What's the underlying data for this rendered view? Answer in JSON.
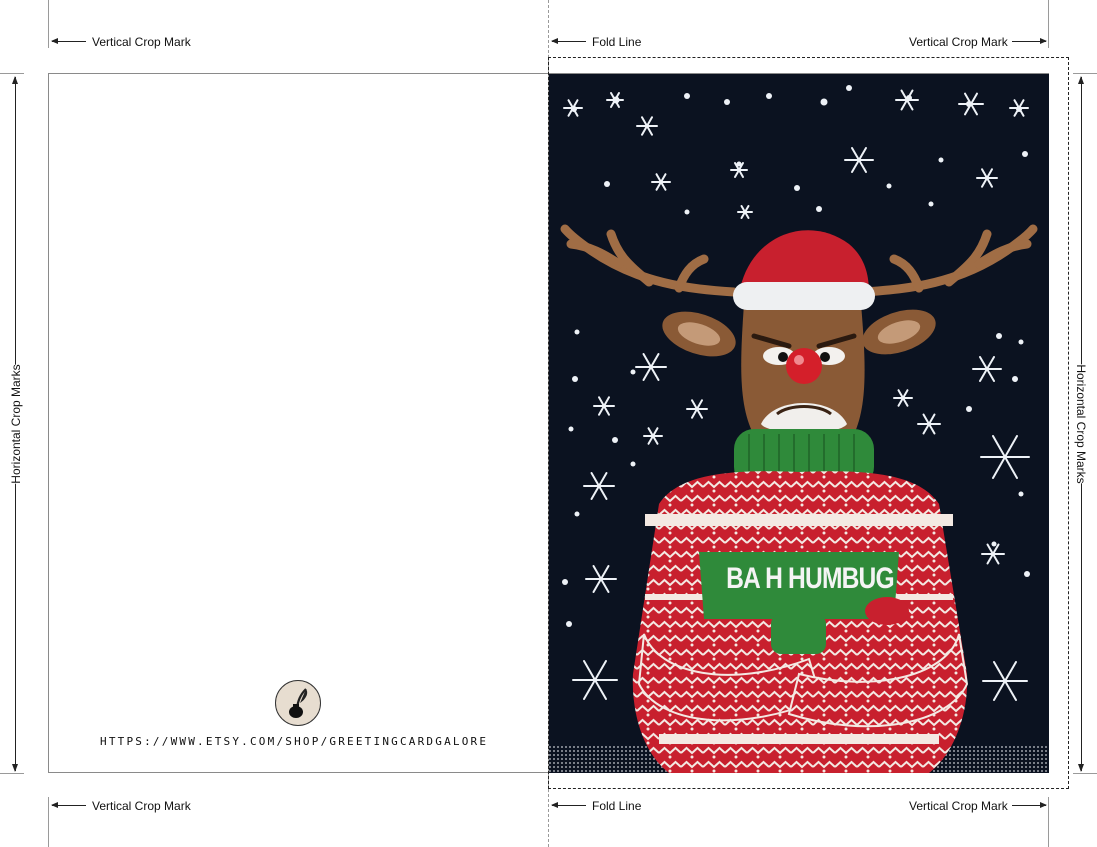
{
  "marks": {
    "vertical_crop_mark": "Vertical Crop Mark",
    "fold_line": "Fold Line",
    "horizontal_crop_marks": "Horizontal Crop Marks"
  },
  "card_back": {
    "url": "HTTPS://WWW.ETSY.COM/SHOP/GREETINGCARDGALORE",
    "logo_icon": "ink-quill-icon"
  },
  "card_front": {
    "sweater_text": "BA H HUMBUG",
    "illustration": "grumpy-reindeer-in-christmas-sweater",
    "colors": {
      "background": "#0b1220",
      "sweater_red": "#c8202e",
      "sweater_green": "#2f8a3a",
      "fur": "#8a5a36"
    }
  }
}
